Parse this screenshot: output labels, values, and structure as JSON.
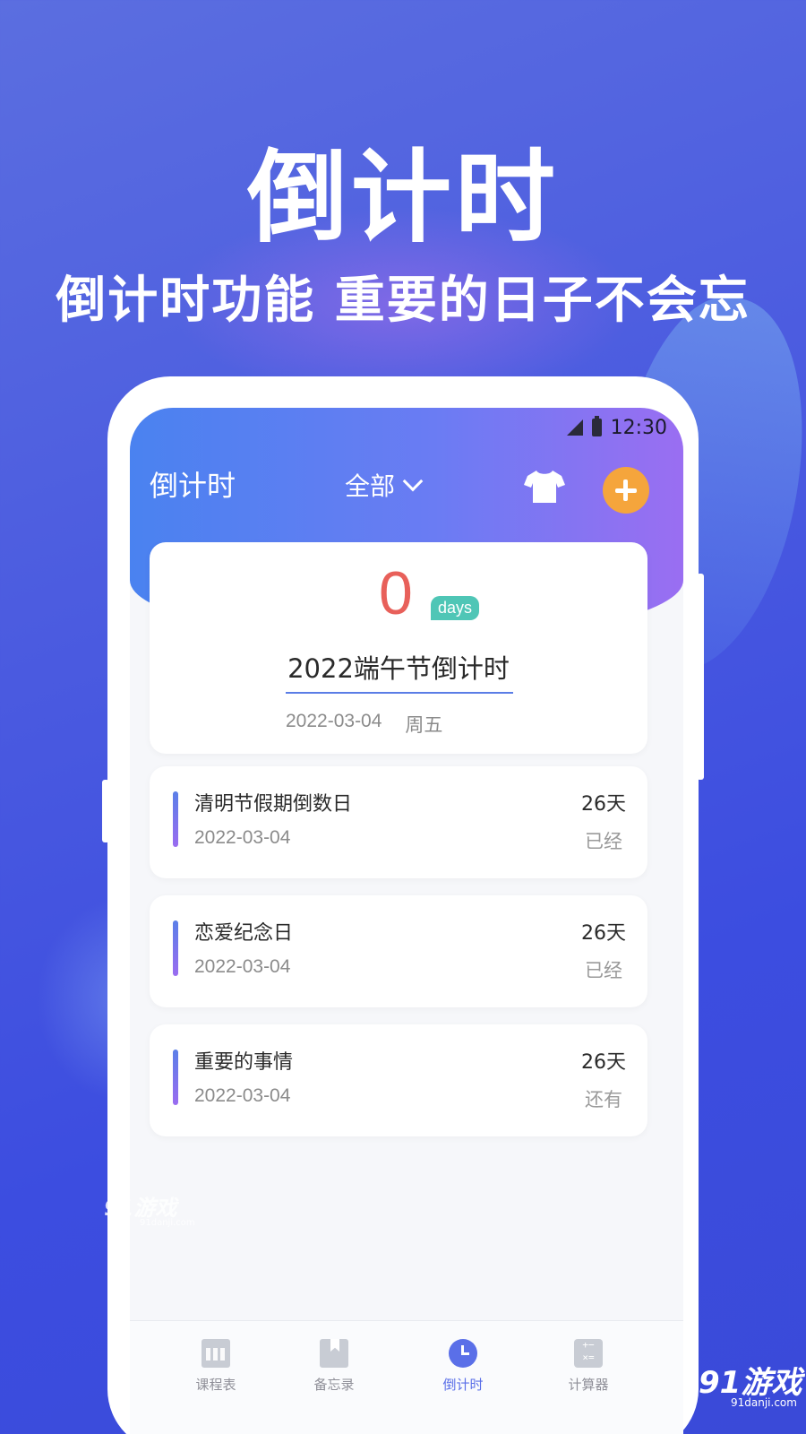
{
  "hero": {
    "title": "倒计时",
    "subtitle": "倒计时功能 重要的日子不会忘"
  },
  "status_bar": {
    "time": "12:30"
  },
  "header": {
    "title": "倒计时",
    "filter_label": "全部",
    "icons": {
      "theme": "shirt-icon",
      "add": "plus-icon"
    }
  },
  "main_event": {
    "days": "0",
    "unit": "days",
    "name": "2022端午节倒计时",
    "date": "2022-03-04",
    "weekday": "周五"
  },
  "events": [
    {
      "name": "清明节假期倒数日",
      "date": "2022-03-04",
      "count": "26天",
      "state": "已经"
    },
    {
      "name": "恋爱纪念日",
      "date": "2022-03-04",
      "count": "26天",
      "state": "已经"
    },
    {
      "name": "重要的事情",
      "date": "2022-03-04",
      "count": "26天",
      "state": "还有"
    }
  ],
  "tabs": [
    {
      "label": "课程表",
      "icon": "timetable-icon"
    },
    {
      "label": "备忘录",
      "icon": "memo-icon"
    },
    {
      "label": "倒计时",
      "icon": "clock-icon",
      "active": true
    },
    {
      "label": "计算器",
      "icon": "calculator-icon"
    }
  ],
  "watermarks": {
    "left_logo": "91游戏",
    "left_url": "91danji.com",
    "right_logo": "91游戏",
    "right_url": "91danji.com"
  },
  "colors": {
    "background": "#4a5ae0",
    "header_gradient_start": "#4a82f0",
    "header_gradient_end": "#9a6ef2",
    "days_number": "#e8605a",
    "days_badge": "#4fc6b6",
    "add_button": "#f5a53c",
    "active_tab": "#5a6fe8"
  }
}
